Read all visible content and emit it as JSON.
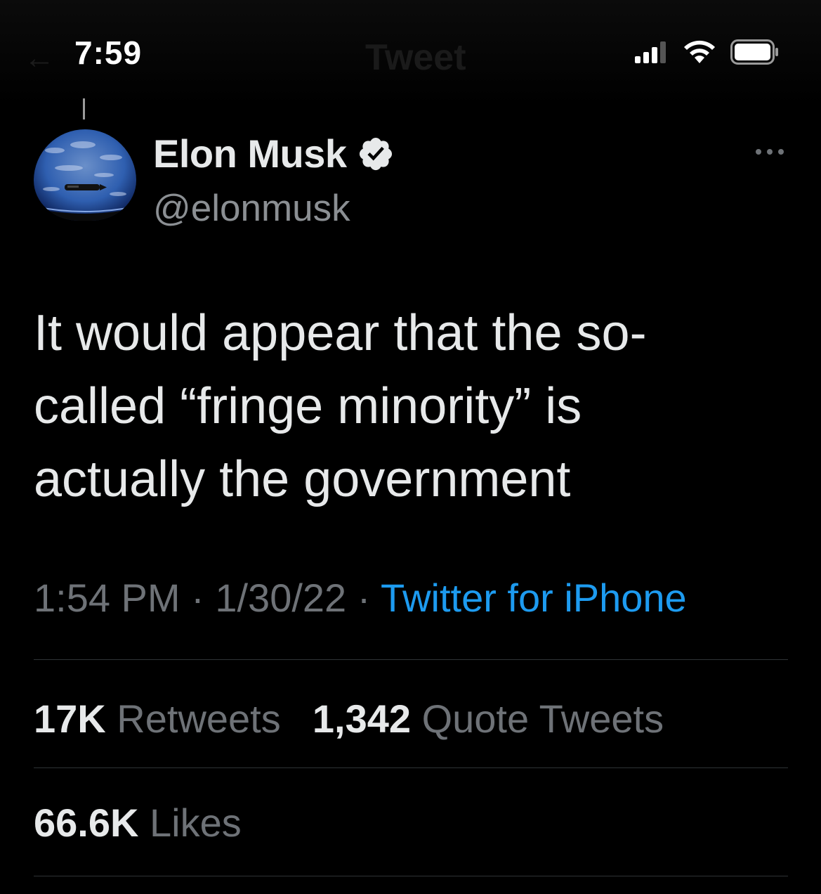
{
  "status_bar": {
    "time": "7:59",
    "signal_icon": "cellular-signal-icon",
    "wifi_icon": "wifi-icon",
    "battery_icon": "battery-icon"
  },
  "header_ghost": {
    "back_icon": "back-arrow-icon",
    "title": "Tweet"
  },
  "tweet": {
    "author": {
      "name": "Elon Musk",
      "handle": "@elonmusk",
      "verified_icon": "verified-badge-icon",
      "avatar": "avatar-image"
    },
    "more_icon": "more-options-icon",
    "text_lines": [
      "It would appear that the so-",
      "called “fringe minority” is",
      "actually the government"
    ],
    "time": "1:54 PM",
    "date": "1/30/22",
    "separator": "·",
    "source": "Twitter for iPhone",
    "stats": {
      "retweets_count": "17K",
      "retweets_label": "Retweets",
      "quotes_count": "1,342",
      "quotes_label": "Quote Tweets",
      "likes_count": "66.6K",
      "likes_label": "Likes"
    }
  },
  "colors": {
    "background": "#000000",
    "text_primary": "#e7e9ea",
    "text_secondary": "#6e7277",
    "link": "#1d9bf0",
    "divider": "#2f3336"
  }
}
